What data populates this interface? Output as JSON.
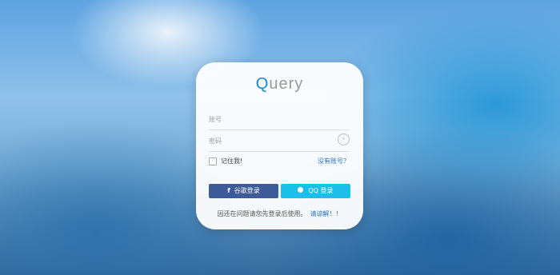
{
  "logo": {
    "first": "Q",
    "rest": "uery"
  },
  "form": {
    "account_placeholder": "账号",
    "password_placeholder": "密码",
    "submit_icon": "›",
    "remember_label": "记住我!",
    "no_account_link": "没有账号？"
  },
  "buttons": {
    "google_icon": "f",
    "google_label": "谷歌登录",
    "qq_label": "QQ 登录"
  },
  "notice": {
    "text": "因还在问题请您先登录后使用。",
    "link": "请谅解！！"
  },
  "colors": {
    "accent": "#1e88d4",
    "google_button": "#3d5b99",
    "qq_button": "#1bbfe9"
  }
}
